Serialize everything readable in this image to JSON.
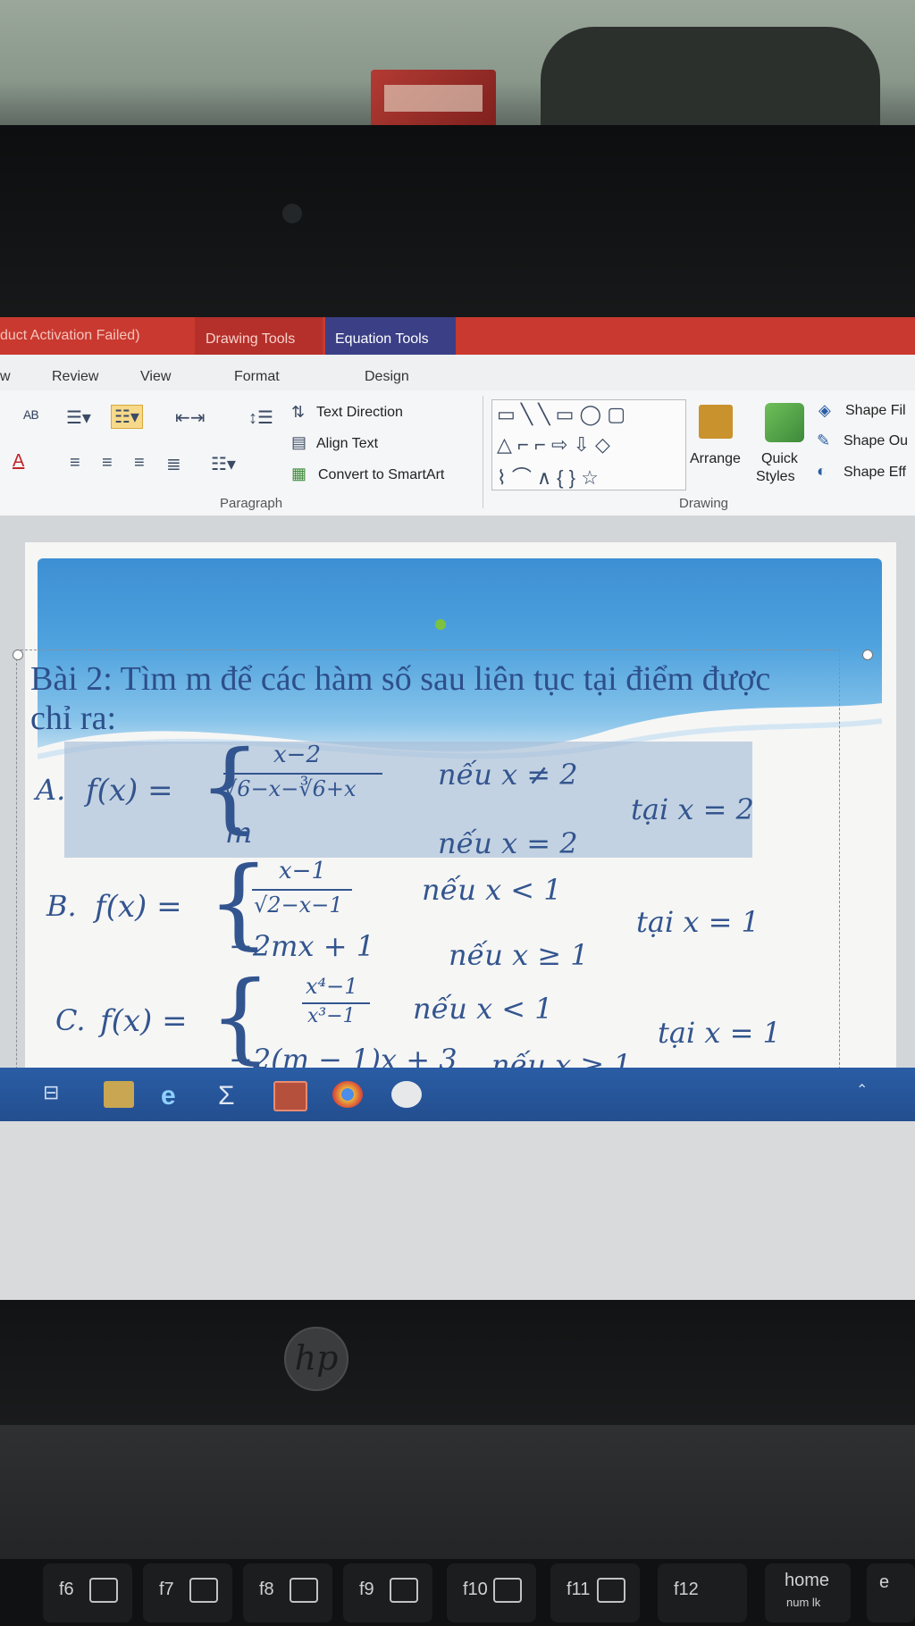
{
  "ribbon": {
    "title_fragment": "duct Activation Failed)",
    "context_tabs": {
      "drawing_tools": "Drawing Tools",
      "equation_tools": "Equation Tools"
    },
    "tabs": {
      "first_fragment": "w",
      "review": "Review",
      "view": "View",
      "format": "Format",
      "design": "Design"
    },
    "paragraph": {
      "text_direction": "Text Direction",
      "align_text": "Align Text",
      "convert_smartart": "Convert to SmartArt",
      "group_label": "Paragraph"
    },
    "drawing": {
      "arrange": "Arrange",
      "quick": "Quick",
      "styles": "Styles",
      "shape_fill": "Shape Fil",
      "shape_outline": "Shape Ou",
      "shape_effects": "Shape Eff",
      "group_label": "Drawing"
    }
  },
  "slide": {
    "title_line1": "Bài 2: Tìm m để các hàm số sau liên tục tại điểm được",
    "title_line2": "chỉ ra:",
    "items": {
      "A": {
        "label": "A.",
        "fx": "f(x) =",
        "numerator": "x−2",
        "denominator": "√6−x−∛6+x",
        "case1_cond": "nếu x ≠ 2",
        "case2_value": "m",
        "case2_cond": "nếu x = 2",
        "at": "tại x = 2"
      },
      "B": {
        "label": "B.",
        "fx": "f(x) =",
        "numerator": "x−1",
        "denominator": "√2−x−1",
        "case1_cond": "nếu x < 1",
        "case2_value": "−2mx + 1",
        "case2_cond": "nếu x ≥ 1",
        "at": "tại x = 1"
      },
      "C": {
        "label": "C.",
        "fx": "f(x) =",
        "numerator": "x⁴−1",
        "denominator": "x³−1",
        "case1_cond": "nếu x < 1",
        "case2_value": "−2(m − 1)x + 3",
        "case2_cond": "nếu x ≥ 1",
        "at": "tại x = 1"
      }
    }
  },
  "keyboard": {
    "keys": [
      "f6",
      "f7",
      "f8",
      "f9",
      "f10",
      "f11",
      "f12",
      "home"
    ],
    "home_sub": "num lk",
    "end_fragment": "e"
  },
  "colors": {
    "titlebar": "#c9392f",
    "equation_tab": "#3b3f86",
    "banner": "#3d8fd3",
    "math_text": "#33558f",
    "taskbar": "#2a5da5"
  },
  "icons": [
    "bullets-icon",
    "numbering-icon",
    "indent-icon",
    "line-spacing-icon",
    "align-left-icon",
    "align-center-icon",
    "align-right-icon",
    "justify-icon",
    "columns-icon",
    "font-color-icon",
    "shape-gallery-icon",
    "arrange-icon",
    "quick-styles-icon",
    "shape-fill-icon",
    "shape-outline-icon",
    "shape-effects-icon",
    "hp-logo-icon"
  ]
}
